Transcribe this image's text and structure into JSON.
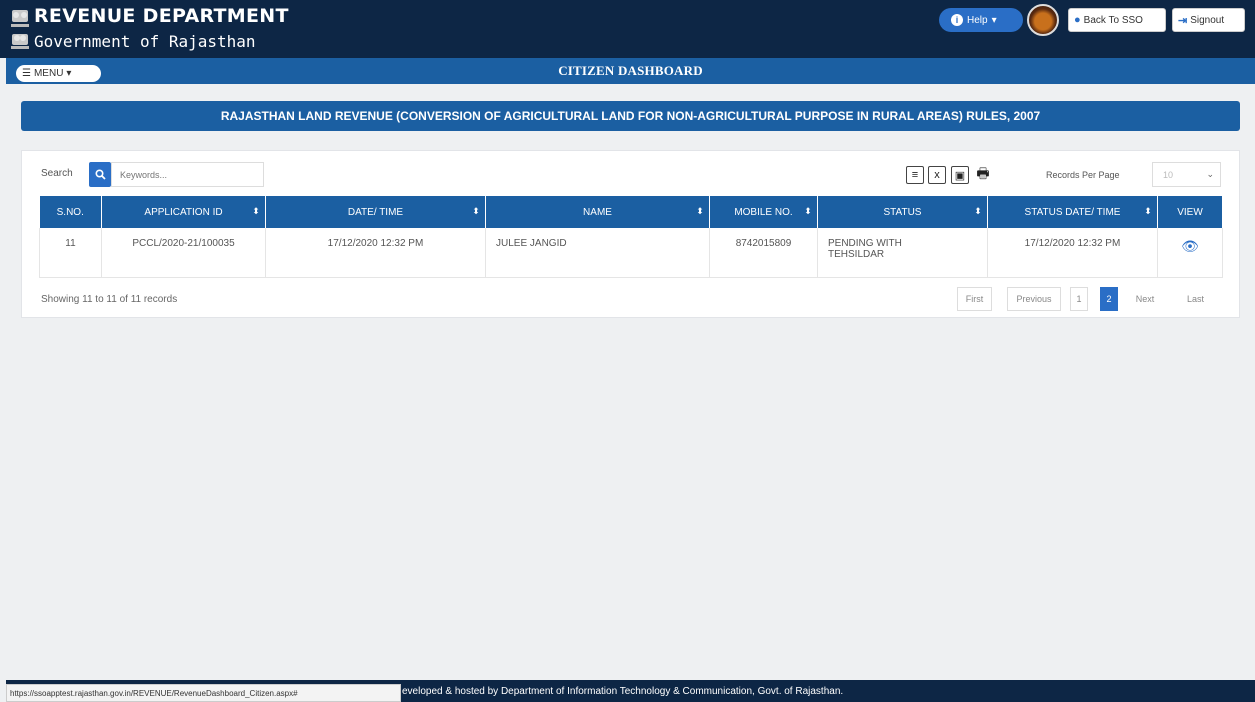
{
  "header": {
    "title": "REVENUE DEPARTMENT",
    "subtitle": "Government of Rajasthan",
    "help_label": "Help",
    "back_label": "Back To SSO",
    "signout_label": "Signout"
  },
  "nav": {
    "menu_label": "MENU",
    "page_title": "CITIZEN DASHBOARD"
  },
  "banner": "RAJASTHAN LAND REVENUE (CONVERSION OF AGRICULTURAL LAND FOR NON-AGRICULTURAL PURPOSE IN RURAL AREAS) RULES, 2007",
  "toolbar": {
    "search_label": "Search",
    "search_placeholder": "Keywords...",
    "records_per_page_label": "Records Per Page",
    "records_per_page_value": "10"
  },
  "table": {
    "columns": [
      "S.NO.",
      "APPLICATION ID",
      "DATE/ TIME",
      "NAME",
      "MOBILE NO.",
      "STATUS",
      "STATUS DATE/ TIME",
      "VIEW"
    ],
    "rows": [
      {
        "sno": "11",
        "application_id": "PCCL/2020-21/100035",
        "date_time": "17/12/2020 12:32 PM",
        "name": "JULEE JANGID",
        "mobile": "8742015809",
        "status": "PENDING WITH TEHSILDAR",
        "status_date_time": "17/12/2020 12:32 PM"
      }
    ]
  },
  "pagination": {
    "showing": "Showing 11 to 11 of 11 records",
    "first": "First",
    "previous": "Previous",
    "page1": "1",
    "page2": "2",
    "next": "Next",
    "last": "Last"
  },
  "footer": {
    "url": "https://ssoapptest.rajasthan.gov.in/REVENUE/RevenueDashboard_Citizen.aspx#",
    "text": "eveloped & hosted by Department of Information Technology & Communication, Govt. of Rajasthan."
  }
}
